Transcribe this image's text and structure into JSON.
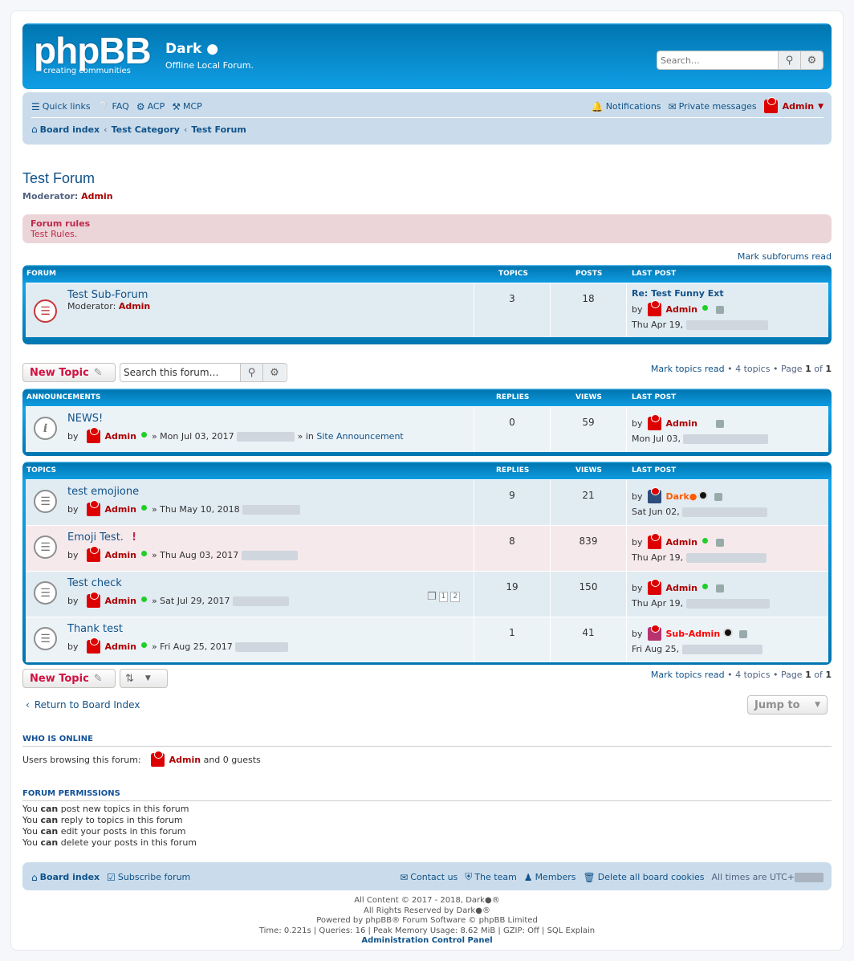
{
  "header": {
    "logo": "phpBB",
    "logo_sub": "creating   communities",
    "site_name": "Dark",
    "site_desc": "Offline Local Forum.",
    "search_placeholder": "Search…"
  },
  "nav": {
    "quick_links": "Quick links",
    "faq": "FAQ",
    "acp": "ACP",
    "mcp": "MCP",
    "notifications": "Notifications",
    "private_messages": "Private messages",
    "user": "Admin",
    "breadcrumb": [
      "Board index",
      "Test Category",
      "Test Forum"
    ]
  },
  "page": {
    "title": "Test Forum",
    "moderator_label": "Moderator:",
    "moderator": "Admin",
    "rules_title": "Forum rules",
    "rules_text": "Test Rules.",
    "mark_subforums": "Mark subforums read"
  },
  "subforums": {
    "headers": [
      "FORUM",
      "TOPICS",
      "POSTS",
      "LAST POST"
    ],
    "rows": [
      {
        "title": "Test Sub-Forum",
        "moderator_label": "Moderator:",
        "moderator": "Admin",
        "topics": "3",
        "posts": "18",
        "last_title": "Re: Test Funny Ext",
        "by": "by",
        "last_user": "Admin",
        "last_date": "Thu Apr 19,"
      }
    ]
  },
  "actions": {
    "new_topic": "New Topic",
    "search_placeholder": "Search this forum…",
    "mark_topics": "Mark topics read",
    "topic_count": "4 topics",
    "page_label": "Page",
    "page_cur": "1",
    "of": "of",
    "page_total": "1"
  },
  "announcements": {
    "headers": [
      "ANNOUNCEMENTS",
      "REPLIES",
      "VIEWS",
      "LAST POST"
    ],
    "rows": [
      {
        "title": "NEWS!",
        "by": "by",
        "author": "Admin",
        "date": "» Mon Jul 03, 2017",
        "in_label": "» in",
        "in_forum": "Site Announcement",
        "replies": "0",
        "views": "59",
        "last_user": "Admin",
        "last_date": "Mon Jul 03,"
      }
    ]
  },
  "topics": {
    "headers": [
      "TOPICS",
      "REPLIES",
      "VIEWS",
      "LAST POST"
    ],
    "rows": [
      {
        "title": "test emojione",
        "by": "by",
        "author": "Admin",
        "date": "» Thu May 10, 2018",
        "replies": "9",
        "views": "21",
        "last_user": "Dark",
        "last_date": "Sat Jun 02,"
      },
      {
        "title": "Emoji Test.",
        "by": "by",
        "author": "Admin",
        "date": "» Thu Aug 03, 2017",
        "replies": "8",
        "views": "839",
        "last_user": "Admin",
        "last_date": "Thu Apr 19,"
      },
      {
        "title": "Test check",
        "by": "by",
        "author": "Admin",
        "date": "» Sat Jul 29, 2017",
        "replies": "19",
        "views": "150",
        "last_user": "Admin",
        "last_date": "Thu Apr 19,",
        "pages": [
          "1",
          "2"
        ]
      },
      {
        "title": "Thank test",
        "by": "by",
        "author": "Admin",
        "date": "» Fri Aug 25, 2017",
        "replies": "1",
        "views": "41",
        "last_user": "Sub-Admin",
        "last_date": "Fri Aug 25,"
      }
    ]
  },
  "bottom": {
    "return": "Return to Board Index",
    "jump_to": "Jump to",
    "who_online_title": "WHO IS ONLINE",
    "who_online_text": "Users browsing this forum:",
    "who_online_user": "Admin",
    "who_online_tail": "and 0 guests",
    "perm_title": "FORUM PERMISSIONS",
    "perms": [
      {
        "pre": "You",
        "can": "can",
        "post": "post new topics in this forum"
      },
      {
        "pre": "You",
        "can": "can",
        "post": "reply to topics in this forum"
      },
      {
        "pre": "You",
        "can": "can",
        "post": "edit your posts in this forum"
      },
      {
        "pre": "You",
        "can": "can",
        "post": "delete your posts in this forum"
      }
    ]
  },
  "footer": {
    "board_index": "Board index",
    "subscribe": "Subscribe forum",
    "contact": "Contact us",
    "team": "The team",
    "members": "Members",
    "delete_cookies": "Delete all board cookies",
    "times": "All times are UTC+",
    "copy1": "All Content © 2017 - 2018, Dark",
    "copy2": "All Rights Reserved by Dark",
    "copy3": "Powered by phpBB® Forum Software © phpBB Limited",
    "copy4": "Time: 0.221s | Queries: 16 | Peak Memory Usage: 8.62 MiB | GZIP: Off | SQL Explain",
    "acp_link": "Administration Control Panel"
  },
  "colors": {
    "brand": "#0076b1",
    "admin": "#aa0000",
    "accent": "#d31141"
  }
}
